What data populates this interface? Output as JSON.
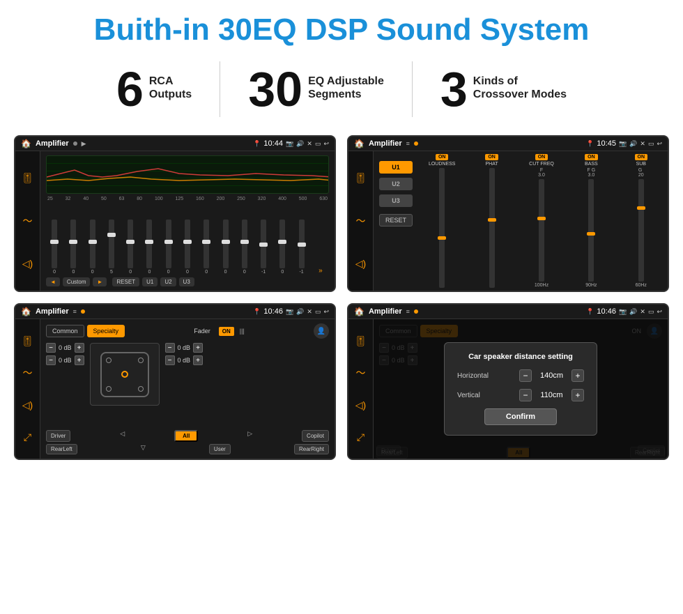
{
  "header": {
    "title": "Buith-in 30EQ DSP Sound System"
  },
  "stats": [
    {
      "number": "6",
      "line1": "RCA",
      "line2": "Outputs"
    },
    {
      "number": "30",
      "line1": "EQ Adjustable",
      "line2": "Segments"
    },
    {
      "number": "3",
      "line1": "Kinds of",
      "line2": "Crossover Modes"
    }
  ],
  "screens": [
    {
      "id": "screen1",
      "app_name": "Amplifier",
      "time": "10:44",
      "title": "EQ Sliders",
      "freq_labels": [
        "25",
        "32",
        "40",
        "50",
        "63",
        "80",
        "100",
        "125",
        "160",
        "200",
        "250",
        "320",
        "400",
        "500",
        "630"
      ],
      "slider_values": [
        "0",
        "0",
        "0",
        "5",
        "0",
        "0",
        "0",
        "0",
        "0",
        "0",
        "0",
        "-1",
        "0",
        "-1"
      ],
      "buttons": [
        "◄",
        "Custom",
        "►",
        "RESET",
        "U1",
        "U2",
        "U3"
      ]
    },
    {
      "id": "screen2",
      "app_name": "Amplifier",
      "time": "10:45",
      "title": "Crossover Controls",
      "u_buttons": [
        "U1",
        "U2",
        "U3"
      ],
      "controls": [
        "LOUDNESS",
        "PHAT",
        "CUT FREQ",
        "BASS",
        "SUB"
      ],
      "on_labels": [
        "ON",
        "ON",
        "ON",
        "ON",
        "ON"
      ]
    },
    {
      "id": "screen3",
      "app_name": "Amplifier",
      "time": "10:46",
      "title": "Fader",
      "tabs": [
        "Common",
        "Specialty"
      ],
      "fader_label": "Fader",
      "on_text": "ON",
      "db_values": [
        "0 dB",
        "0 dB",
        "0 dB",
        "0 dB"
      ],
      "bottom_btns": [
        "Driver",
        "All",
        "Copilot",
        "RearLeft",
        "User",
        "RearRight"
      ]
    },
    {
      "id": "screen4",
      "app_name": "Amplifier",
      "time": "10:46",
      "title": "Distance Dialog",
      "tabs": [
        "Common",
        "Specialty"
      ],
      "dialog": {
        "title": "Car speaker distance setting",
        "horizontal_label": "Horizontal",
        "horizontal_value": "140cm",
        "vertical_label": "Vertical",
        "vertical_value": "110cm",
        "confirm_label": "Confirm"
      },
      "db_values": [
        "0 dB",
        "0 dB"
      ],
      "bottom_btns": [
        "Driver",
        "Copilot",
        "RearLeft",
        "RearRight"
      ]
    }
  ]
}
